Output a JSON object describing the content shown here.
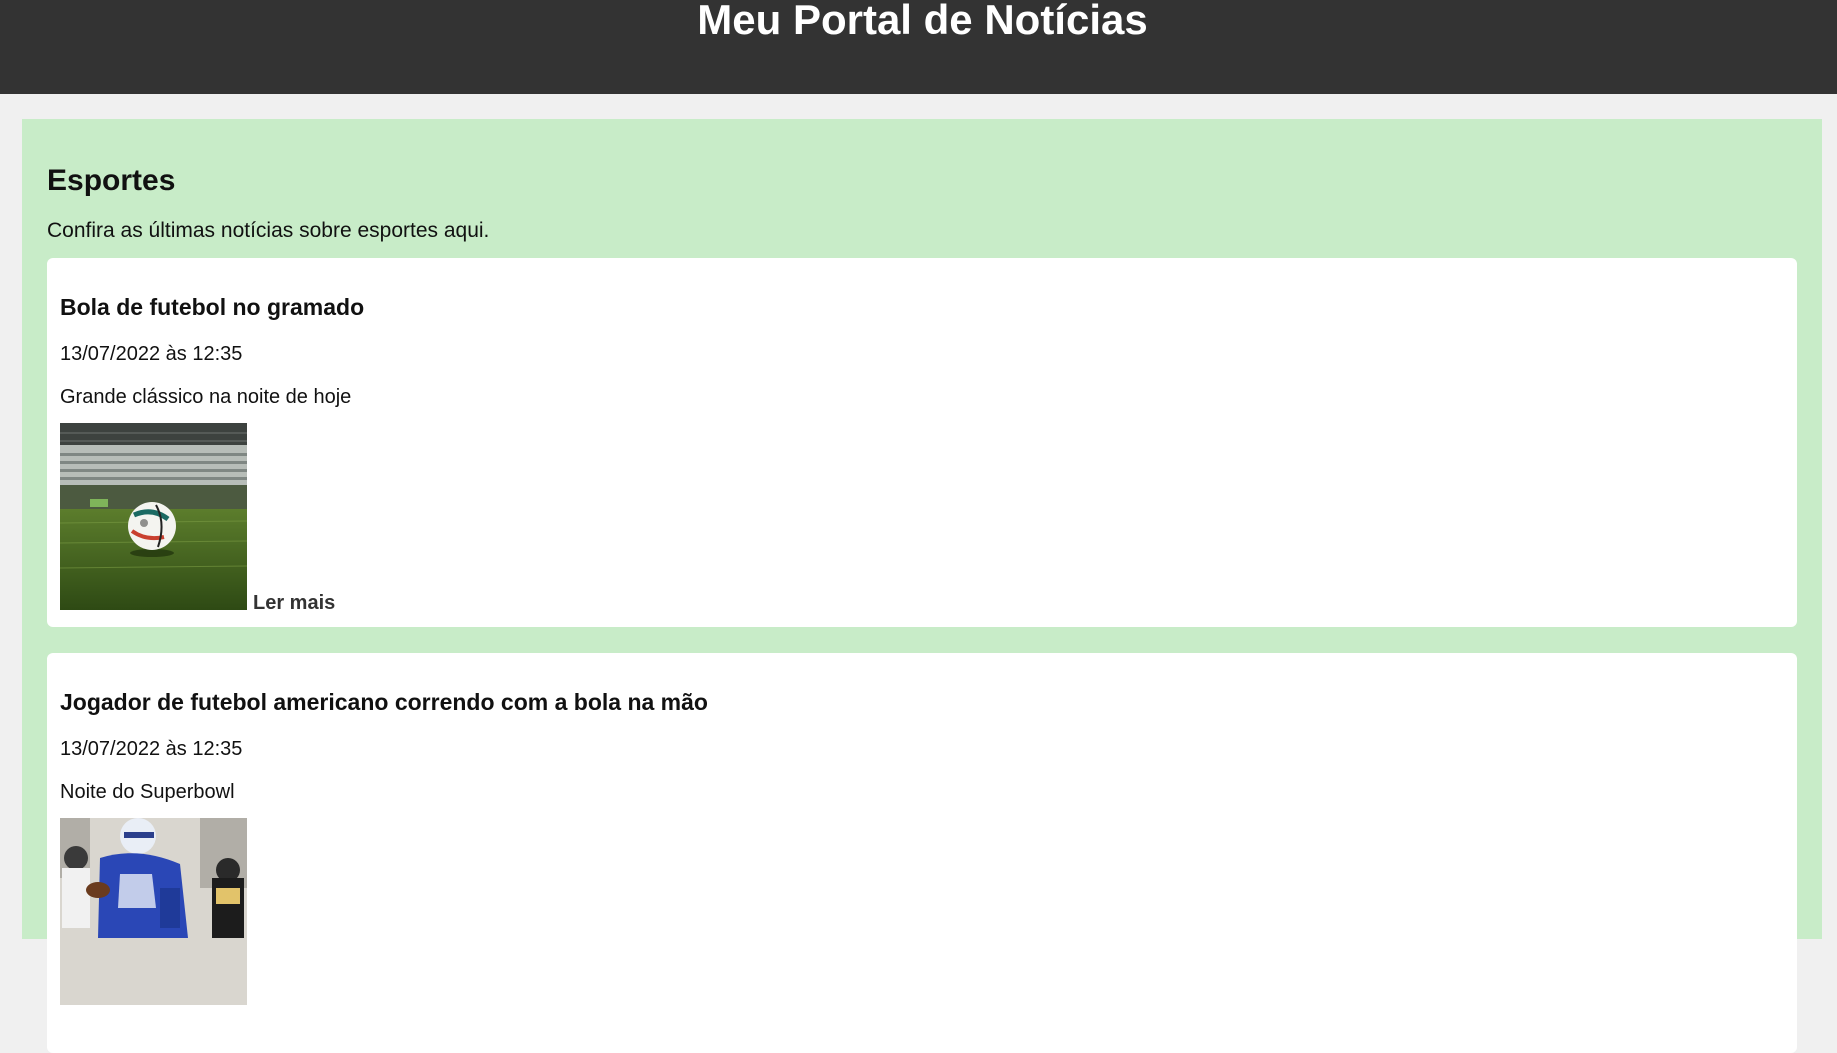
{
  "header": {
    "title": "Meu Portal de Notícias"
  },
  "section": {
    "title": "Esportes",
    "description": "Confira as últimas notícias sobre esportes aqui."
  },
  "articles": [
    {
      "title": "Bola de futebol no gramado",
      "date": "13/07/2022 às 12:35",
      "summary": "Grande clássico na noite de hoje",
      "read_more": "Ler mais",
      "image_icon": "soccer-ball-on-grass-image"
    },
    {
      "title": "Jogador de futebol americano correndo com a bola na mão",
      "date": "13/07/2022 às 12:35",
      "summary": "Noite do Superbowl",
      "image_icon": "american-football-player-image"
    }
  ],
  "colors": {
    "header_bg": "#333333",
    "section_bg": "#c8ecc8",
    "card_bg": "#ffffff",
    "page_bg": "#f0f0f0"
  }
}
